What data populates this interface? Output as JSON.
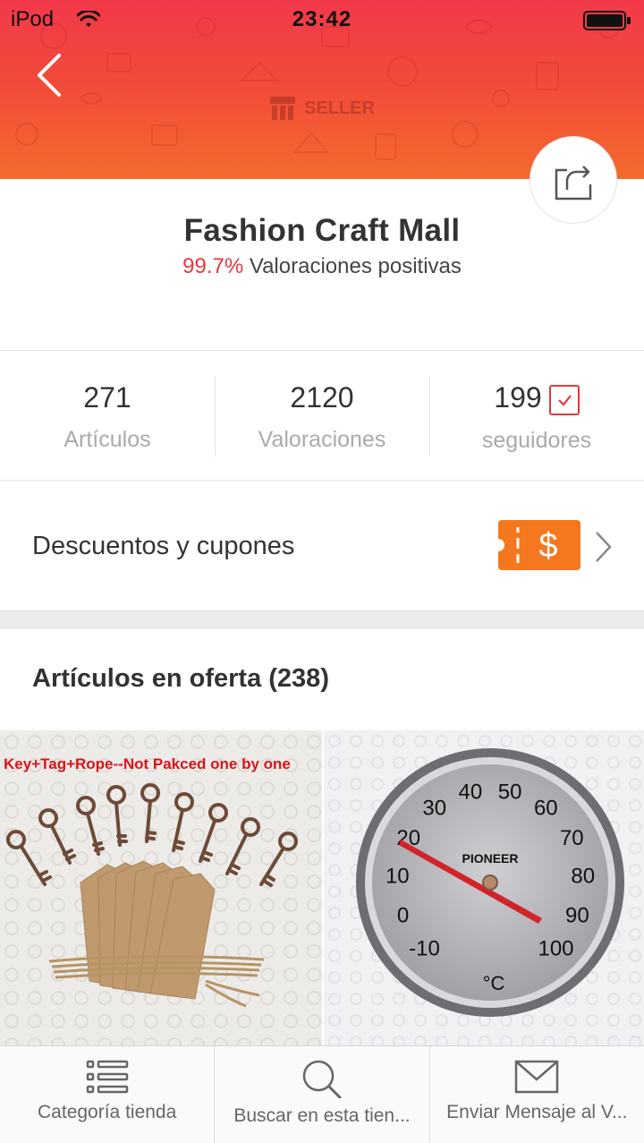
{
  "status_bar": {
    "carrier": "iPod",
    "time": "23:42"
  },
  "header": {
    "seller_badge": "SELLER",
    "colors": {
      "gradient_top": "#f2384a",
      "gradient_bottom": "#f46a2e"
    }
  },
  "store": {
    "name": "Fashion Craft Mall",
    "rating_percent": "99.7%",
    "rating_text": " Valoraciones positivas"
  },
  "stats": [
    {
      "value": "271",
      "label": "Artículos"
    },
    {
      "value": "2120",
      "label": "Valoraciones"
    },
    {
      "value": "199",
      "label": "seguidores"
    }
  ],
  "coupons": {
    "label": "Descuentos y cupones",
    "badge_symbol": "$",
    "badge_color": "#f5781f"
  },
  "offers": {
    "title": "Artículos en oferta (238)",
    "products": [
      {
        "caption": "Key+Tag+Rope--Not Pakced one by one",
        "image": "skeleton-keys-with-kraft-tags-and-twine"
      },
      {
        "image": "pioneer-dial-thermometer",
        "dial_brand": "PIONEER",
        "dial_unit": "°C",
        "dial_numbers": [
          "-10",
          "0",
          "10",
          "20",
          "30",
          "40",
          "50",
          "60",
          "70",
          "80",
          "90",
          "100"
        ]
      }
    ]
  },
  "tabbar": [
    {
      "label": "Categoría tienda",
      "icon": "list-icon"
    },
    {
      "label": "Buscar en esta tien...",
      "icon": "search-icon"
    },
    {
      "label": "Enviar Mensaje al V...",
      "icon": "envelope-icon"
    }
  ],
  "accent_color": "#e4393c"
}
